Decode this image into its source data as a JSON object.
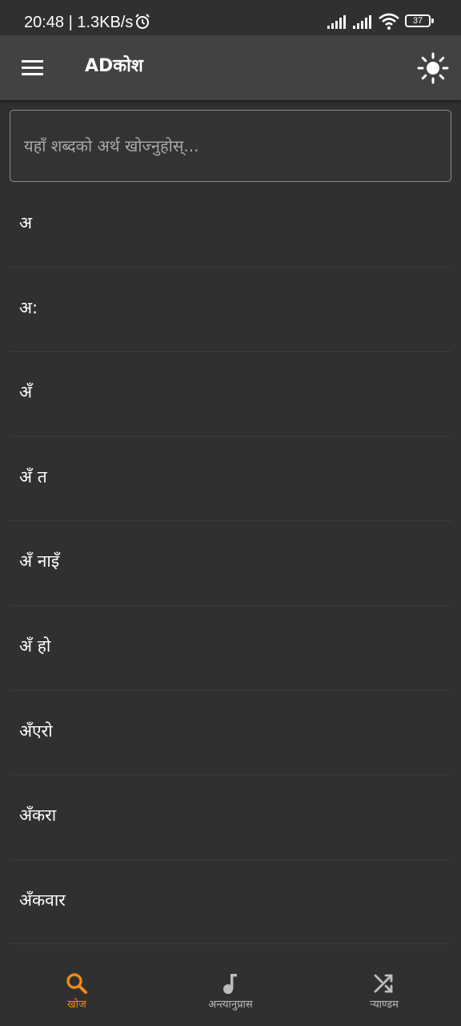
{
  "status_bar": {
    "time": "20:48 | 1.3KB/s",
    "battery": "37"
  },
  "app_bar": {
    "title": "ADकोश"
  },
  "search": {
    "placeholder": "यहाँ शब्दको अर्थ खोज्नुहोस्..."
  },
  "words": [
    "अ",
    "अ:",
    "अँ",
    "अँ त",
    "अँ नाइँ",
    "अँ हो",
    "अँएरो",
    "अँकरा",
    "अँकवार"
  ],
  "bottom_nav": {
    "search_label": "खोज",
    "rhyme_label": "अन्त्यानुप्रास",
    "random_label": "र्‍याण्डम"
  },
  "colors": {
    "accent": "#ef8a1a",
    "background": "#303030",
    "app_bar": "#424242",
    "inactive": "#bdbdbd"
  },
  "icons": {
    "menu": "menu-icon",
    "theme": "brightness-icon",
    "search_tab": "search-icon",
    "rhyme_tab": "music-note-icon",
    "random_tab": "shuffle-icon"
  }
}
